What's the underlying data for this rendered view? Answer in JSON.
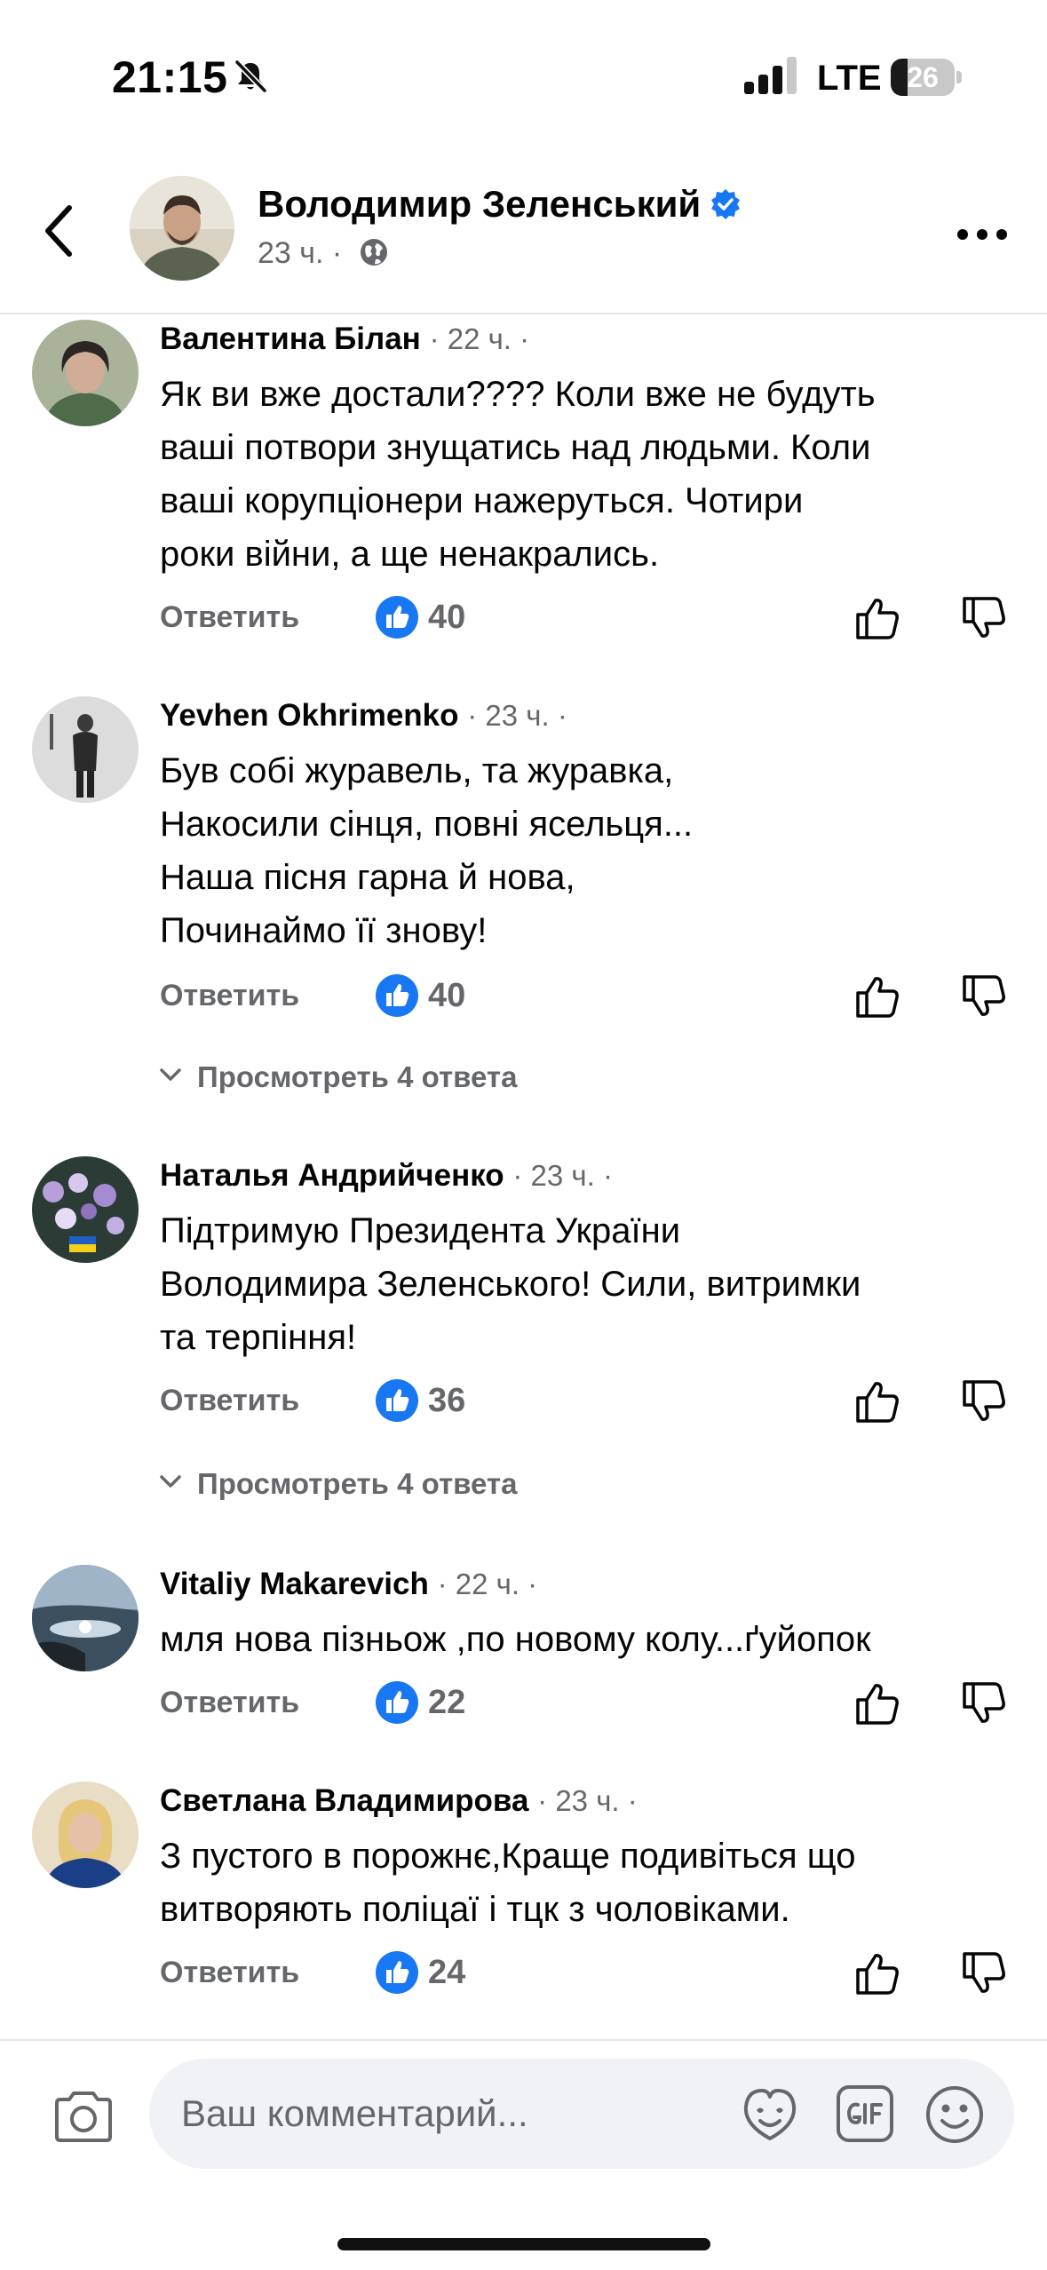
{
  "status_bar": {
    "time": "21:15",
    "network": "LTE",
    "battery": "26",
    "battery_level": 0.26
  },
  "header": {
    "name": "Володимир Зеленський",
    "time": "23 ч.",
    "separator": "·"
  },
  "comments": [
    {
      "author": "Валентина Білан",
      "time": "· 22 ч. ·",
      "lines": [
        "Як ви вже достали???? Коли вже не будуть",
        "ваші потвори знущатись над людьми. Коли",
        "ваші корупціонери нажеруться. Чотири",
        "роки війни, а ще ненакрались."
      ],
      "reply_label": "Ответить",
      "likes": "40"
    },
    {
      "author": "Yevhen Okhrimenko",
      "time": "· 23 ч. ·",
      "lines": [
        "Був собі журавель, та журавка,",
        "Накосили сінця, повні ясельця...",
        "Наша пісня гарна й нова,",
        "Починаймо її знову!"
      ],
      "reply_label": "Ответить",
      "likes": "40",
      "replies_label": "Просмотреть 4 ответа"
    },
    {
      "author": "Наталья Андрийченко",
      "time": "· 23 ч. ·",
      "lines": [
        "Підтримую Президента України",
        "Володимира Зеленського! Сили, витримки",
        "та терпіння!"
      ],
      "reply_label": "Ответить",
      "likes": "36",
      "replies_label": "Просмотреть 4 ответа"
    },
    {
      "author": "Vitaliy Makarevich",
      "time": "· 22 ч. ·",
      "lines": [
        "мля нова пізньож ,по новому колу...ґуйопок"
      ],
      "reply_label": "Ответить",
      "likes": "22"
    },
    {
      "author": "Светлана Владимирова",
      "time": "· 23 ч. ·",
      "lines": [
        "З пустого в порожнє,Краще подивіться що",
        "витворяють поліцаї і тцк з чоловіками."
      ],
      "reply_label": "Ответить",
      "likes": "24"
    }
  ],
  "composer": {
    "placeholder": "Ваш комментарий..."
  },
  "icons": {
    "back": "chevron-left-icon",
    "more": "more-horizontal-icon",
    "verified": "verified-badge-icon",
    "audience": "globe-icon",
    "like": "like-badge-icon",
    "thumb_up": "thumb-up-icon",
    "thumb_down": "thumb-down-icon",
    "camera": "camera-icon",
    "sticker": "sticker-icon",
    "gif": "gif-icon",
    "emoji": "emoji-icon"
  },
  "colors": {
    "accent": "#1877F2",
    "secondary_text": "#65676B",
    "input_bg": "#F0F2F5"
  }
}
